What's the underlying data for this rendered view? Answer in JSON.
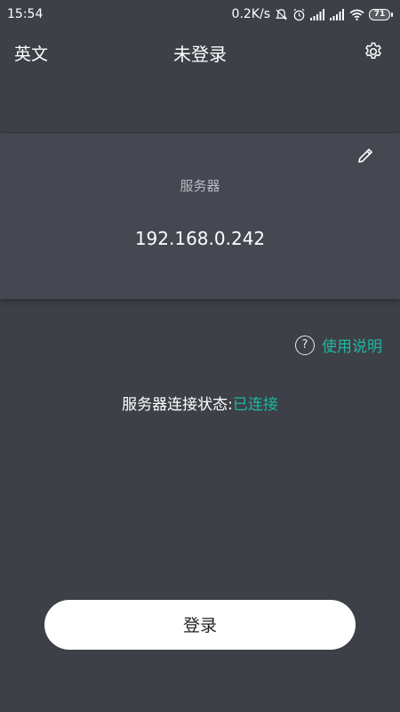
{
  "status_bar": {
    "time": "15:54",
    "net_speed": "0.2K/s",
    "battery_level": "71",
    "icons": [
      "mute-alarm-icon",
      "alarm-clock-icon",
      "signal-icon",
      "signal-icon",
      "wifi-icon",
      "battery-icon"
    ]
  },
  "header": {
    "language_label": "英文",
    "title": "未登录",
    "settings_icon": "gear-icon"
  },
  "server_card": {
    "edit_icon": "pencil-icon",
    "label": "服务器",
    "address": "192.168.0.242"
  },
  "help": {
    "icon": "question-circle-icon",
    "label": "使用说明"
  },
  "connection": {
    "label": "服务器连接状态:",
    "value": "已连接"
  },
  "login_button": {
    "label": "登录"
  },
  "colors": {
    "background": "#3d4047",
    "card": "#454850",
    "accent": "#1fb7a2",
    "text": "#ffffff"
  }
}
